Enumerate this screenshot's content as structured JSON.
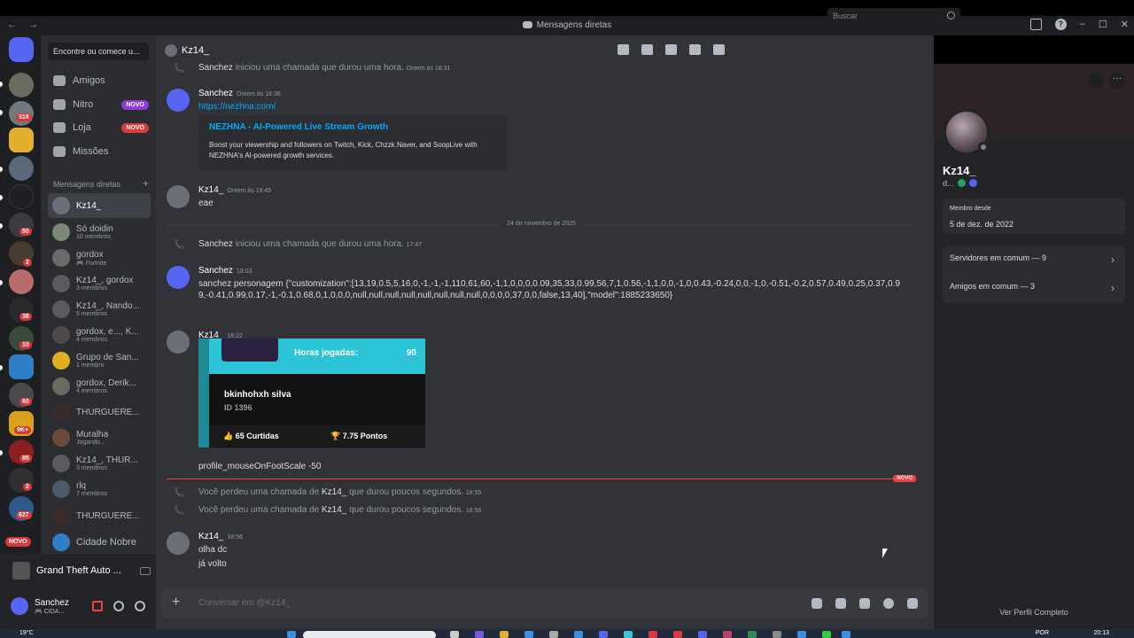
{
  "window": {
    "title": "Mensagens diretas",
    "back": "←",
    "forward": "→"
  },
  "dm_sidebar": {
    "search_placeholder": "Encontre ou comece u...",
    "nav": [
      {
        "label": "Amigos",
        "badge": ""
      },
      {
        "label": "Nitro",
        "badge": "NOVO"
      },
      {
        "label": "Loja",
        "badge": "NOVO"
      },
      {
        "label": "Missões",
        "badge": ""
      }
    ],
    "header": "Mensagens diretas",
    "dms": [
      {
        "name": "Kz14_",
        "sub": ""
      },
      {
        "name": "Só doidin",
        "sub": "10 membros"
      },
      {
        "name": "gordox",
        "sub": "🎮 Fortnite"
      },
      {
        "name": "Kz14_, gordox",
        "sub": "3 membros"
      },
      {
        "name": "Kz14_, Nando...",
        "sub": "5 membros"
      },
      {
        "name": "gordox, e..., K...",
        "sub": "4 membros"
      },
      {
        "name": "Grupo de San...",
        "sub": "1 membro"
      },
      {
        "name": "gordox, Derik...",
        "sub": "4 membros"
      },
      {
        "name": "THURGUERE...",
        "sub": ""
      },
      {
        "name": "Muralha",
        "sub": "Jogando..."
      },
      {
        "name": "Kz14_, THUR...",
        "sub": "3 membros"
      },
      {
        "name": "rlq",
        "sub": "7 membros"
      },
      {
        "name": "THURGUERE...",
        "sub": ""
      },
      {
        "name": "Cidade Nobre",
        "sub": ""
      }
    ]
  },
  "server_rail": {
    "badges": [
      "318",
      "50",
      "2",
      "38",
      "10",
      "60",
      "9K+",
      "85",
      "2",
      "627"
    ],
    "new_label": "NOVO"
  },
  "user_panel": {
    "activity": "Grand Theft Auto ...",
    "name": "Sanchez",
    "status": "🎮 CIDA..."
  },
  "chat": {
    "recipient": "Kz14_",
    "search_placeholder": "Buscar",
    "messages": {
      "call1": {
        "who": "Sanchez",
        "text": " iniciou uma chamada que durou uma hora.",
        "time": "Ontem às 18:31"
      },
      "m1": {
        "author": "Sanchez",
        "time": "Ontem às 18:36",
        "link": "https://nezhna.com/",
        "embed_title": "NEZHNA - AI-Powered Live Stream Growth",
        "embed_desc": "Boost your viewership and followers on Twitch, Kick, Chzzk.Naver, and SoopLive with NEZHNA's AI-powered growth services."
      },
      "m2": {
        "author": "Kz14_",
        "time": "Ontem às 19:45",
        "text": "eae"
      },
      "date_divider": "24 de novembro de 2025",
      "call2": {
        "who": "Sanchez",
        "text": " iniciou uma chamada que durou uma hora.",
        "time": "17:47"
      },
      "m3": {
        "author": "Sanchez",
        "time": "18:03",
        "text": "sanchez personagem {\"customization\":[13,19,0.5,5,16,0,-1,-1,-1,110,61,60,-1,1,0,0,0,0.09,35,33,0.99,56,7,1,0.56,-1,1,0,0,-1,0,0.43,-0.24,0,0,-1,0,-0.51,-0.2,0.57,0.49,0.25,0.37,0.99,-0.41,0.99,0.17,-1,-0.1,0.68,0,1,0,0,0,null,null,null,null,null,null,null,null,0,0,0,0,37,0,0,false,13,40],\"model\":1885233650}"
      },
      "m4": {
        "author": "Kz14_",
        "time": "18:22",
        "card": {
          "label": "Horas jogadas:",
          "value": "90",
          "name": "bkinhohxh silva",
          "id": "ID 1396",
          "likes": "👍 65 Curtidas",
          "points": "🏆 7.75 Pontos"
        },
        "text": "profile_mouseOnFootScale -50"
      },
      "new_label": "NOVO",
      "miss1": {
        "pre": "Você perdeu uma chamada de ",
        "who": "Kz14_",
        "post": " que durou poucos segundos.",
        "time": "18:55"
      },
      "miss2": {
        "pre": "Você perdeu uma chamada de ",
        "who": "Kz14_",
        "post": " que durou poucos segundos.",
        "time": "18:56"
      },
      "m5": {
        "author": "Kz14_",
        "time": "18:56",
        "line1": "olha dc",
        "line2": "já volto"
      }
    },
    "input_placeholder": "Conversar em @Kz14_"
  },
  "profile": {
    "name": "Kz14_",
    "tag": "d...",
    "member_since_label": "Membro desde",
    "member_since": "5 de dez. de 2022",
    "servers_common": "Servidores em comum — 9",
    "friends_common": "Amigos em comum — 3",
    "full_profile": "Ver Perfil Completo"
  },
  "taskbar": {
    "weather": "19°C",
    "lang": "POR",
    "time": "20:13"
  },
  "colors": {
    "accent": "#5865f2",
    "new_badge": "#f23f42",
    "link": "#00a8fc",
    "online": "#23a559"
  }
}
